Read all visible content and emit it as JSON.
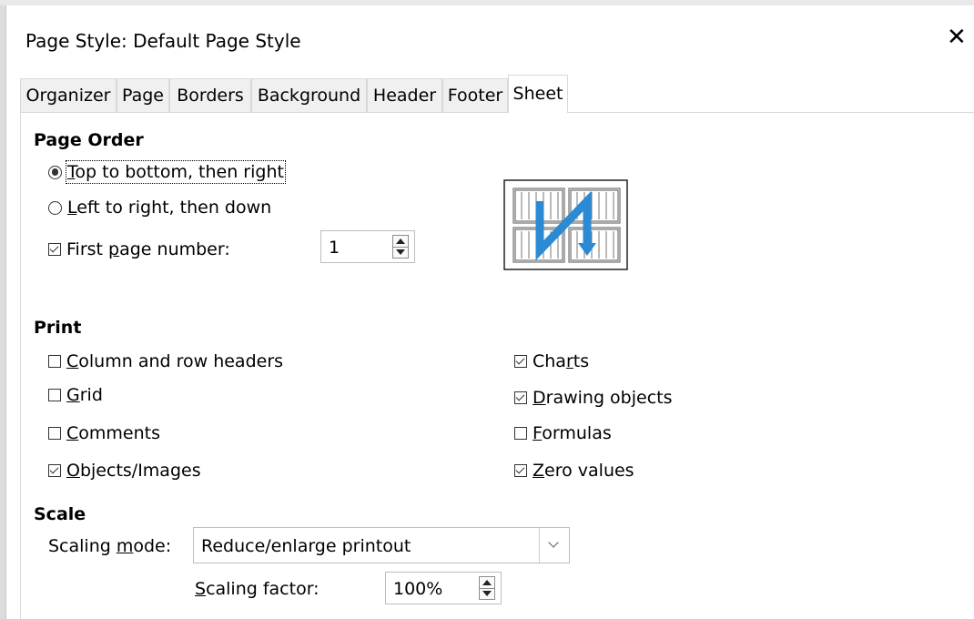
{
  "window": {
    "title": "Page Style: Default Page Style",
    "close_glyph": "✕"
  },
  "tabs": [
    {
      "label": "Organizer",
      "active": false
    },
    {
      "label": "Page",
      "active": false
    },
    {
      "label": "Borders",
      "active": false
    },
    {
      "label": "Background",
      "active": false
    },
    {
      "label": "Header",
      "active": false
    },
    {
      "label": "Footer",
      "active": false
    },
    {
      "label": "Sheet",
      "active": true
    }
  ],
  "page_order": {
    "heading": "Page Order",
    "top_to_bottom": {
      "pre": "",
      "mnemonic": "T",
      "post": "op to bottom, then right",
      "selected": true
    },
    "left_to_right": {
      "pre": "",
      "mnemonic": "L",
      "post": "eft to right, then down",
      "selected": false
    },
    "first_page": {
      "pre": "First ",
      "mnemonic": "p",
      "post": "age number:",
      "checked": true,
      "value": "1"
    },
    "preview_icon": "page-order-preview-icon"
  },
  "print": {
    "heading": "Print",
    "left": [
      {
        "pre": "",
        "mnemonic": "C",
        "post": "olumn and row headers",
        "checked": false
      },
      {
        "pre": "",
        "mnemonic": "G",
        "post": "rid",
        "checked": false
      },
      {
        "pre": "",
        "mnemonic": "C",
        "post": "omments",
        "checked": false
      },
      {
        "pre": "",
        "mnemonic": "O",
        "post": "bjects/Images",
        "checked": true
      }
    ],
    "right": [
      {
        "pre": "Cha",
        "mnemonic": "r",
        "post": "ts",
        "checked": true
      },
      {
        "pre": "",
        "mnemonic": "D",
        "post": "rawing objects",
        "checked": true
      },
      {
        "pre": "",
        "mnemonic": "F",
        "post": "ormulas",
        "checked": false
      },
      {
        "pre": "",
        "mnemonic": "Z",
        "post": "ero values",
        "checked": true
      }
    ]
  },
  "scale": {
    "heading": "Scale",
    "mode_label": {
      "pre": "Scaling ",
      "mnemonic": "m",
      "post": "ode:"
    },
    "mode_value": "Reduce/enlarge printout",
    "factor_label": {
      "pre": "",
      "mnemonic": "S",
      "post": "caling factor:"
    },
    "factor_value": "100%"
  },
  "colors": {
    "accent": "#2a8ad4"
  }
}
